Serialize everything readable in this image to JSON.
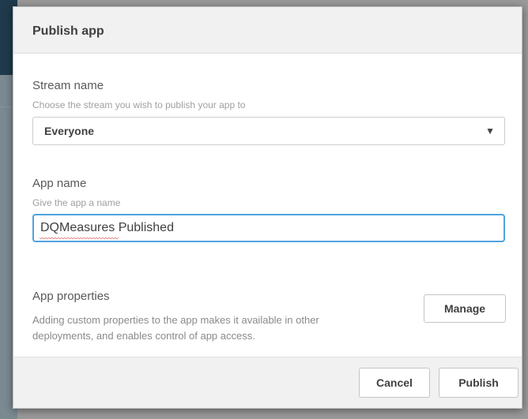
{
  "dialog": {
    "title": "Publish app"
  },
  "stream": {
    "label": "Stream name",
    "hint": "Choose the stream you wish to publish your app to",
    "selected": "Everyone",
    "caret_icon": "triangle-down-icon"
  },
  "app_name": {
    "label": "App name",
    "hint": "Give the app a name",
    "value": "DQMeasures Published"
  },
  "app_properties": {
    "label": "App properties",
    "description": "Adding custom properties to the app makes it available in other deployments, and enables control of app access.",
    "manage_label": "Manage"
  },
  "footer": {
    "cancel_label": "Cancel",
    "publish_label": "Publish"
  },
  "colors": {
    "input_focus_border": "#4fa3e0",
    "header_background": "#f1f1f1",
    "spellcheck_underline": "#d92020"
  }
}
